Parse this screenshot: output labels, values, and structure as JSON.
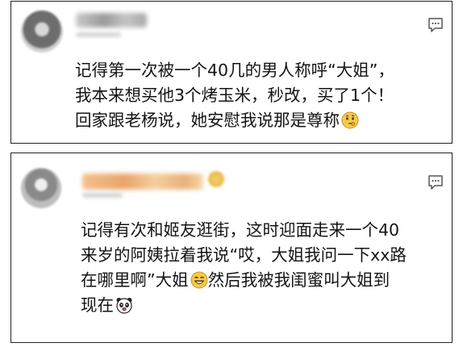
{
  "comments": [
    {
      "lines": [
        "记得第一次被一个40几的男人称呼“大姐”，",
        "我本来想买他3个烤玉米，秒改，买了1个！",
        "回家跟老杨说，她安慰我说那是尊称"
      ],
      "emoji": "thinking-emoji"
    },
    {
      "lines": [
        "记得有次和姬友逛街，这时迎面走来一个40",
        "来岁的阿姨拉着我说“哎，大姐我问一下xx路",
        "在哪里啊”大姐",
        "然后我被我闺蜜叫大姐到",
        "现在"
      ],
      "emojis": [
        "grin-emoji",
        "panda-emoji"
      ]
    }
  ],
  "colors": {
    "border": "#222222",
    "text": "#141414",
    "name_blur_2": "#e8a46a"
  }
}
